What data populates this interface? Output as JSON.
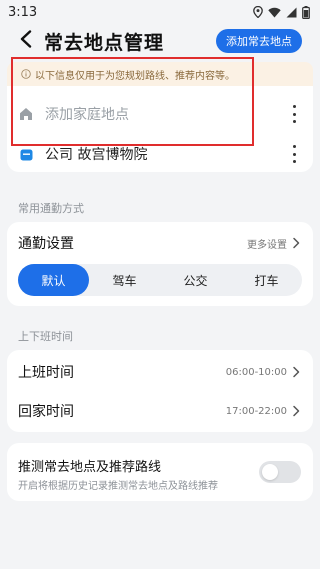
{
  "status_bar": {
    "time": "3:13"
  },
  "header": {
    "title": "常去地点管理",
    "add_button": "添加常去地点"
  },
  "places": {
    "notice": "以下信息仅用于为您规划路线、推荐内容等。",
    "home": {
      "label": "添加家庭地点"
    },
    "company": {
      "label": "公司 故宫博物院"
    }
  },
  "commute": {
    "section_title": "常用通勤方式",
    "settings_label": "通勤设置",
    "settings_value": "更多设置",
    "modes": [
      {
        "label": "默认",
        "active": true
      },
      {
        "label": "驾车",
        "active": false
      },
      {
        "label": "公交",
        "active": false
      },
      {
        "label": "打车",
        "active": false
      }
    ]
  },
  "schedule": {
    "section_title": "上下班时间",
    "work": {
      "label": "上班时间",
      "value": "06:00-10:00"
    },
    "home": {
      "label": "回家时间",
      "value": "17:00-22:00"
    }
  },
  "predict": {
    "title": "推测常去地点及推荐路线",
    "description": "开启将根据历史记录推测常去地点及路线推荐",
    "enabled": false
  },
  "colors": {
    "accent": "#1e6fe8",
    "highlight_border": "#e02d2d",
    "notice_bg": "#fbf1e4"
  }
}
